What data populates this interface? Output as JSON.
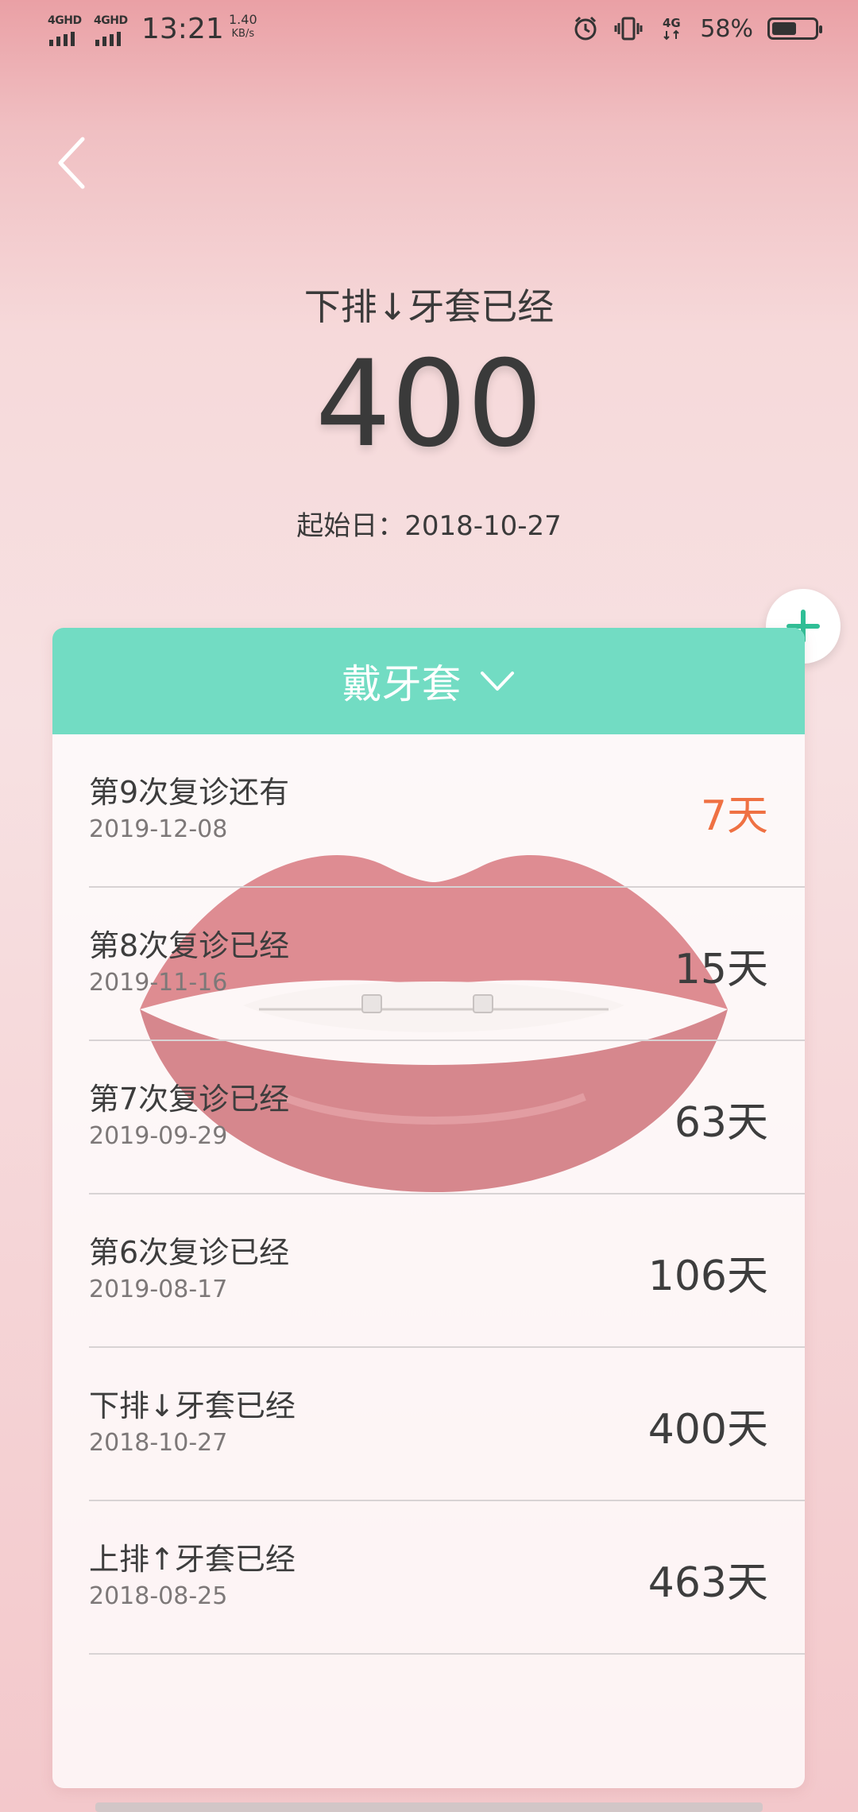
{
  "status_bar": {
    "net1": "4GHD",
    "net2": "4GHD",
    "time": "13:21",
    "speed_value": "1.40",
    "speed_unit": "KB/s",
    "net3": "4G",
    "battery_pct": "58%",
    "battery_level": 0.58
  },
  "header": {
    "subtitle": "下排↓牙套已经",
    "big_number": "400",
    "start_date": "起始日：2018-10-27"
  },
  "card": {
    "title": "戴牙套",
    "rows": [
      {
        "label": "第9次复诊还有",
        "date": "2019-12-08",
        "days": "7天"
      },
      {
        "label": "第8次复诊已经",
        "date": "2019-11-16",
        "days": "15天"
      },
      {
        "label": "第7次复诊已经",
        "date": "2019-09-29",
        "days": "63天"
      },
      {
        "label": "第6次复诊已经",
        "date": "2019-08-17",
        "days": "106天"
      },
      {
        "label": "下排↓牙套已经",
        "date": "2018-10-27",
        "days": "400天"
      },
      {
        "label": "上排↑牙套已经",
        "date": "2018-08-25",
        "days": "463天"
      }
    ]
  },
  "colors": {
    "accent_green": "#72dcc3",
    "accent_orange": "#ef7143"
  }
}
